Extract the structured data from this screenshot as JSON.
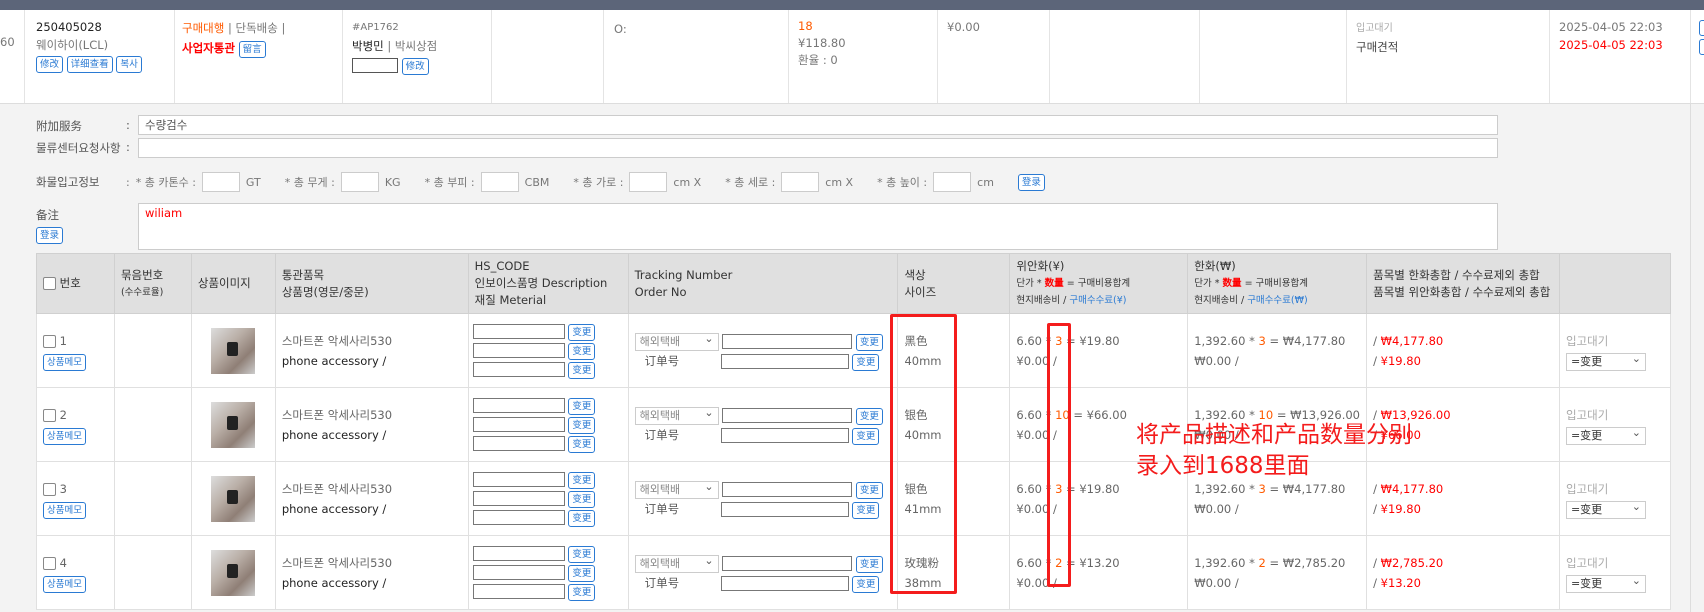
{
  "order": {
    "gutter": "60",
    "id": "250405028",
    "shipper": "웨이하이(LCL)",
    "btn_edit": "修改",
    "btn_detail": "详细查看",
    "btn_copy": "복사",
    "type1": "구매대행",
    "type_sep": " | 단독배송 |",
    "type2": "사업자통관",
    "btn_memo": "留言",
    "code": "#AP1762",
    "name": "박병민",
    "shop": " | 박씨상점",
    "btn_edit2": "修改",
    "o_label": "O:",
    "qty": "18",
    "amount": "¥118.80",
    "rate": "환율 : 0",
    "fee": "¥0.00",
    "status1": "입고대기",
    "status2": "구매견적",
    "date1": "2025-04-05 22:03",
    "date2": "2025-04-05 22:03"
  },
  "details": {
    "service_label": "附加服务",
    "service_value": "수량검수",
    "center_label": "물류센터요청사항",
    "center_value": "",
    "cargo_label": "화물입고정보",
    "cartons": "* 총 카톤수 :",
    "gt": "GT",
    "weight": "* 총 무게 :",
    "kg": "KG",
    "volume": "* 총 부피 :",
    "cbm": "CBM",
    "width": "* 총 가로 :",
    "cmx1": "cm X",
    "depth": "* 총 세로 :",
    "cmx2": "cm X",
    "height": "* 총 높이 :",
    "cm": "cm",
    "btn_reg": "登录",
    "note_label": "备注",
    "note_value": "wiliam",
    "btn_reg2": "登录"
  },
  "table": {
    "headers": {
      "no": "번호",
      "bundle": "묶음번호",
      "bundle_sub": "(수수료율)",
      "image": "상품이미지",
      "customs": "통관품목",
      "pname": "상품명(영문/중문)",
      "hs": "HS_CODE",
      "desc": "인보이스품명 Description",
      "mat": "재질 Meterial",
      "track": "Tracking Number",
      "orderno": "Order No",
      "color": "색상",
      "size": "사이즈",
      "cny": "위안화(¥)",
      "formula_a": "단가 *",
      "formula_qty": "数量",
      "formula_b": "= 구매비용합계",
      "local": "현지배송비 /",
      "fee_cny": "구매수수료(¥)",
      "krw": "한화(₩)",
      "fee_krw": "구매수수료(₩)",
      "total1": "품목별 한화총합 / 수수료제외 총합",
      "total2": "품목별 위안화총합 / 수수료제외 총합"
    },
    "row_memo": "상품메모",
    "change": "变更",
    "carrier": "해외택배",
    "order_label": "订单号",
    "status": "입고대기",
    "status_select": "=变更",
    "rows": [
      {
        "no": "1",
        "kr": "스마트폰 악세사리530",
        "en": "phone accessory /",
        "color": "黑色",
        "size": "40mm",
        "unit": "6.60 *",
        "qty": "3",
        "cny_total": "= ¥19.80",
        "cny_ship": "¥0.00 /",
        "krw_unit": "1,392.60 *",
        "krw_total": "= ₩4,177.80",
        "krw_ship": "₩0.00 /",
        "sum_krw": "₩4,177.80",
        "sum_cny": "¥19.80"
      },
      {
        "no": "2",
        "kr": "스마트폰 악세사리530",
        "en": "phone accessory /",
        "color": "银色",
        "size": "40mm",
        "unit": "6.60 *",
        "qty": "10",
        "cny_total": "= ¥66.00",
        "cny_ship": "¥0.00 /",
        "krw_unit": "1,392.60 *",
        "krw_total": "= ₩13,926.00",
        "krw_ship": "₩0.00 /",
        "sum_krw": "₩13,926.00",
        "sum_cny": "¥66.00"
      },
      {
        "no": "3",
        "kr": "스마트폰 악세사리530",
        "en": "phone accessory /",
        "color": "银色",
        "size": "41mm",
        "unit": "6.60 *",
        "qty": "3",
        "cny_total": "= ¥19.80",
        "cny_ship": "¥0.00 /",
        "krw_unit": "1,392.60 *",
        "krw_total": "= ₩4,177.80",
        "krw_ship": "₩0.00 /",
        "sum_krw": "₩4,177.80",
        "sum_cny": "¥19.80"
      },
      {
        "no": "4",
        "kr": "스마트폰 악세사리530",
        "en": "phone accessory /",
        "color": "玫瑰粉",
        "size": "38mm",
        "unit": "6.60 *",
        "qty": "2",
        "cny_total": "= ¥13.20",
        "cny_ship": "¥0.00 /",
        "krw_unit": "1,392.60 *",
        "krw_total": "= ₩2,785.20",
        "krw_ship": "₩0.00 /",
        "sum_krw": "₩2,785.20",
        "sum_cny": "¥13.20"
      }
    ]
  },
  "annotation": {
    "line1": "将产品描述和产品数量分别",
    "line2": "录入到1688里面",
    "color": "#f41c1c"
  }
}
